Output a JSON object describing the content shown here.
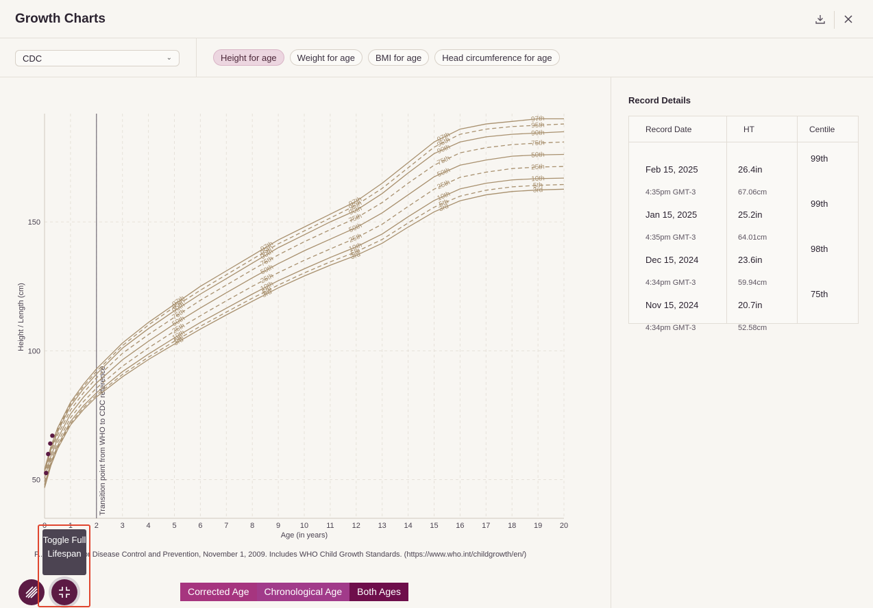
{
  "header": {
    "title": "Growth Charts",
    "download_icon": "download-icon",
    "close_icon": "close-icon"
  },
  "filters": {
    "reference": "CDC",
    "chips": [
      "Height for age",
      "Weight for age",
      "BMI for age",
      "Head circumference for age"
    ],
    "active_chip": "Height for age"
  },
  "colors": {
    "accent": "#5c1a44",
    "curve": "#a8906e",
    "active_chip_bg": "#ecd6e0",
    "age_corrected": "#a6357f",
    "age_chronological": "#a13b8a",
    "age_both": "#6e0e4b",
    "highlight_border": "#e0452f"
  },
  "chart_data": {
    "type": "line",
    "ylabel": "Height / Length (cm)",
    "xlabel": "Age (in years)",
    "xlim": [
      0,
      20
    ],
    "ylim": [
      35,
      192
    ],
    "x_ticks": [
      "0",
      "1",
      "2",
      "3",
      "4",
      "5",
      "6",
      "7",
      "8",
      "9",
      "10",
      "11",
      "12",
      "13",
      "14",
      "15",
      "16",
      "17",
      "18",
      "19",
      "20"
    ],
    "y_ticks": [
      "50",
      "100",
      "150"
    ],
    "transition_label": "Transition point from WHO to CDC reference",
    "transition_x": 2,
    "x": [
      0,
      0.25,
      0.5,
      1,
      1.5,
      2,
      3,
      4,
      5,
      6,
      7,
      8,
      9,
      10,
      11,
      12,
      13,
      14,
      15,
      16,
      17,
      18,
      19,
      20
    ],
    "series": [
      {
        "name": "97th",
        "dashed": false,
        "values": [
          54,
          63,
          70,
          80,
          87,
          93,
          103,
          111,
          118,
          125,
          131,
          137,
          143,
          148,
          153,
          158,
          165,
          173,
          181,
          186,
          188,
          189,
          190,
          190
        ]
      },
      {
        "name": "95th",
        "dashed": true,
        "values": [
          53.5,
          62.5,
          69.3,
          79.3,
          86.2,
          92,
          102,
          110,
          117,
          123.5,
          129.5,
          135.5,
          141.5,
          146.5,
          151.5,
          156.5,
          163,
          171,
          179,
          184,
          186,
          187,
          187.5,
          188
        ]
      },
      {
        "name": "90th",
        "dashed": false,
        "values": [
          53,
          61.7,
          68.5,
          78.5,
          85.3,
          91,
          101,
          108.6,
          115.5,
          122,
          128,
          134,
          140,
          145,
          150,
          154.5,
          161,
          169,
          176.5,
          181,
          183,
          184,
          184.5,
          185
        ]
      },
      {
        "name": "75th",
        "dashed": true,
        "values": [
          51.8,
          60.6,
          67.2,
          77,
          83.7,
          89.5,
          99,
          106.3,
          113,
          119.6,
          125.5,
          131.4,
          137.2,
          142.3,
          147,
          151.5,
          157.5,
          165,
          172,
          176.8,
          178.8,
          180,
          180.6,
          181
        ]
      },
      {
        "name": "50th",
        "dashed": false,
        "values": [
          50.5,
          59.3,
          65.8,
          75.5,
          82,
          87.5,
          96.5,
          103.7,
          110.4,
          116.6,
          122.5,
          128.3,
          133.8,
          138.8,
          143.3,
          147.8,
          153.5,
          160.5,
          167.5,
          172,
          174,
          175.5,
          176,
          176.2
        ]
      },
      {
        "name": "25th",
        "dashed": true,
        "values": [
          49.2,
          58,
          64.4,
          74,
          80.3,
          85.5,
          94,
          101.1,
          107.6,
          113.6,
          119.4,
          125,
          130.3,
          135.1,
          139.5,
          143.8,
          149.1,
          156,
          162.7,
          167.3,
          169.3,
          170.7,
          171.3,
          171.5
        ]
      },
      {
        "name": "10th",
        "dashed": false,
        "values": [
          48,
          56.8,
          63.1,
          72.6,
          78.7,
          83.7,
          91.9,
          98.7,
          105,
          111,
          116.5,
          122,
          127.2,
          131.8,
          136.2,
          140.3,
          145.3,
          152,
          158.3,
          162.8,
          165,
          166.3,
          166.8,
          167
        ]
      },
      {
        "name": "5th",
        "dashed": true,
        "values": [
          47.3,
          56.1,
          62.4,
          71.8,
          77.9,
          82.8,
          90.8,
          97.5,
          103.7,
          109.5,
          115,
          120.4,
          125.5,
          130.2,
          134.5,
          138.4,
          143.2,
          149.6,
          155.7,
          160,
          162.3,
          163.6,
          164.2,
          164.5
        ]
      },
      {
        "name": "3rd",
        "dashed": false,
        "values": [
          46.8,
          55.6,
          61.9,
          71.2,
          77.2,
          82.1,
          89.9,
          96.6,
          102.6,
          108.4,
          113.9,
          119.2,
          124.4,
          129,
          133.2,
          137,
          141.7,
          148,
          153.9,
          158.2,
          160.5,
          161.8,
          162.4,
          162.7
        ]
      }
    ],
    "patient_points": [
      {
        "x": 0.06,
        "y": 52.58
      },
      {
        "x": 0.14,
        "y": 59.94
      },
      {
        "x": 0.22,
        "y": 64.01
      },
      {
        "x": 0.3,
        "y": 67.06
      }
    ]
  },
  "footnote": "P... e Centers for Disease Control and Prevention, November 1, 2009. Includes WHO Child Growth Standards. (https://www.who.int/childgrowth/en/)",
  "age_toggle": [
    "Corrected Age",
    "Chronological Age",
    "Both Ages"
  ],
  "tooltip": "Toggle Full Lifespan",
  "record_details": {
    "title": "Record Details",
    "columns": [
      "Record Date",
      "HT",
      "Centile"
    ],
    "rows": [
      {
        "date": "Feb 15, 2025",
        "time": "4:35pm GMT-3",
        "ht": "26.4in",
        "cm": "67.06cm",
        "centile": "99th"
      },
      {
        "date": "Jan 15, 2025",
        "time": "4:35pm GMT-3",
        "ht": "25.2in",
        "cm": "64.01cm",
        "centile": "99th"
      },
      {
        "date": "Dec 15, 2024",
        "time": "4:34pm GMT-3",
        "ht": "23.6in",
        "cm": "59.94cm",
        "centile": "98th"
      },
      {
        "date": "Nov 15, 2024",
        "time": "4:34pm GMT-3",
        "ht": "20.7in",
        "cm": "52.58cm",
        "centile": "75th"
      }
    ]
  }
}
